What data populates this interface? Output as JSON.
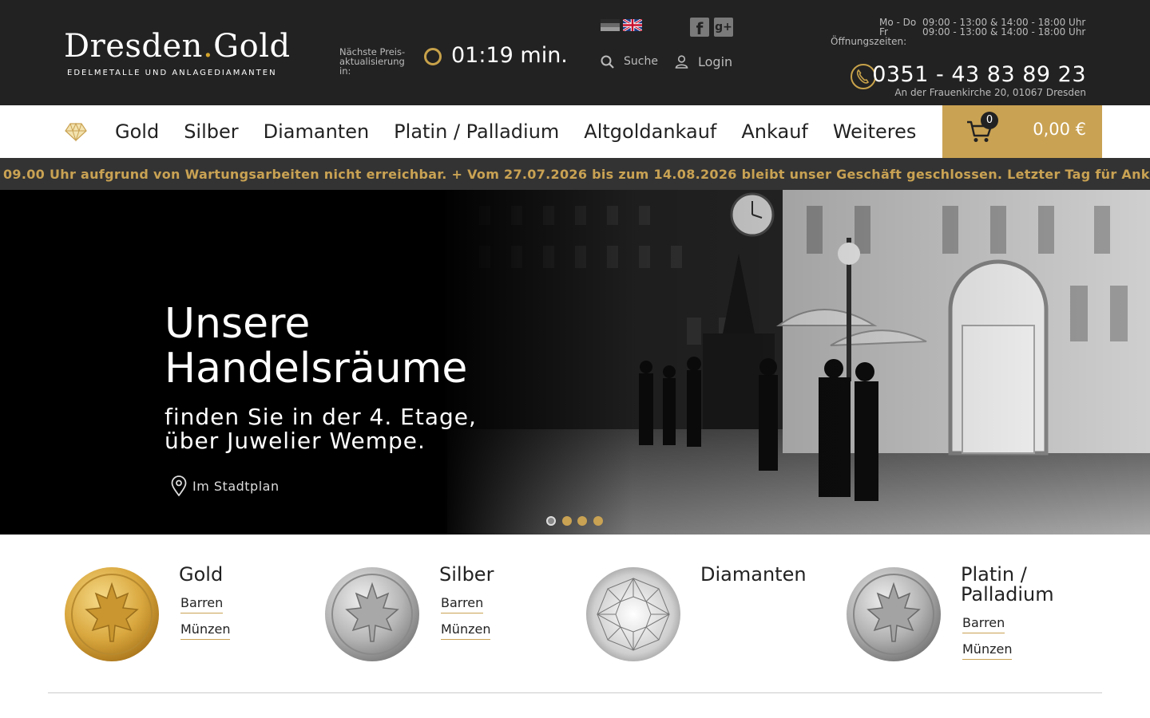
{
  "header": {
    "logo": {
      "name_a": "Dresden",
      "name_b": "Gold",
      "tagline": "EDELMETALLE UND ANLAGEDIAMANTEN"
    },
    "price_update": {
      "label": "Nächste Preis-aktualisierung in:",
      "timer": "01:19 min."
    },
    "languages": [
      "de-flag-icon",
      "en-flag-icon"
    ],
    "social": [
      "facebook-icon",
      "google-plus-icon"
    ],
    "search_label": "Suche",
    "login_label": "Login",
    "hours": {
      "label": "Öffnungszeiten:",
      "rows": [
        {
          "days": "Mo - Do",
          "time": "09:00 - 13:00 & 14:00 - 18:00 Uhr"
        },
        {
          "days": "Fr",
          "time": "09:00 - 13:00 & 14:00 - 18:00 Uhr"
        }
      ]
    },
    "phone": "0351 - 43 83 89 23",
    "address": "An der Frauenkirche 20, 01067 Dresden"
  },
  "nav": {
    "items": [
      "Gold",
      "Silber",
      "Diamanten",
      "Platin / Palladium",
      "Altgoldankauf",
      "Ankauf",
      "Weiteres"
    ],
    "cart_count": "0",
    "cart_total": "0,00 €"
  },
  "ticker": {
    "text": "09.00 Uhr aufgrund von Wartungsarbeiten nicht erreichbar.   +    Vom 27.07.2026 bis zum 14.08.2026 bleibt unser Geschäft geschlossen. Letzter Tag für Ankäufe"
  },
  "hero": {
    "title_line1": "Unsere",
    "title_line2": "Handelsräume",
    "sub_line1": "finden Sie in der 4. Etage,",
    "sub_line2": "über Juwelier Wempe.",
    "link": "Im Stadtplan",
    "slide_count": 4,
    "active_slide": 1
  },
  "categories": [
    {
      "title": "Gold",
      "links": [
        "Barren",
        "Münzen"
      ],
      "image": "gold-coin"
    },
    {
      "title": "Silber",
      "links": [
        "Barren",
        "Münzen"
      ],
      "image": "silver-coin"
    },
    {
      "title": "Diamanten",
      "links": [],
      "image": "diamond"
    },
    {
      "title_line1": "Platin /",
      "title_line2": "Palladium",
      "links": [
        "Barren",
        "Münzen"
      ],
      "image": "platinum-coin"
    }
  ],
  "colors": {
    "accent": "#c9a253",
    "header_bg": "#222222",
    "ticker_bg": "#333333"
  }
}
